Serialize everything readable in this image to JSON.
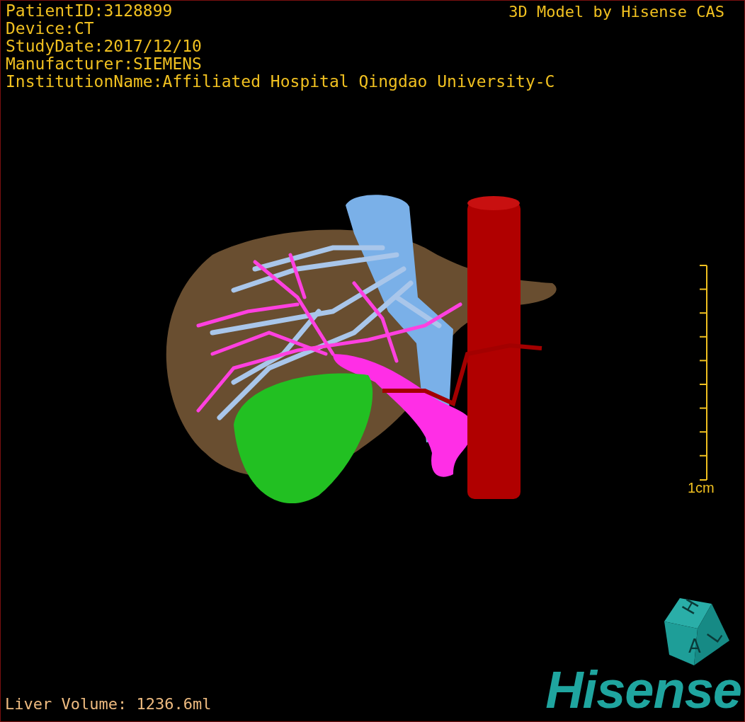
{
  "patient_info": [
    "PatientID:3128899",
    "Device:CT",
    "StudyDate:2017/12/10",
    "Manufacturer:SIEMENS",
    "InstitutionName:Affiliated Hospital Qingdao University-C"
  ],
  "title": "3D Model by Hisense CAS",
  "scale_bar": {
    "label": "1cm"
  },
  "orientation_cube": {
    "labels": [
      "H",
      "A",
      "L"
    ]
  },
  "logo": "Hisense",
  "liver_volume": "Liver Volume: 1236.6ml"
}
